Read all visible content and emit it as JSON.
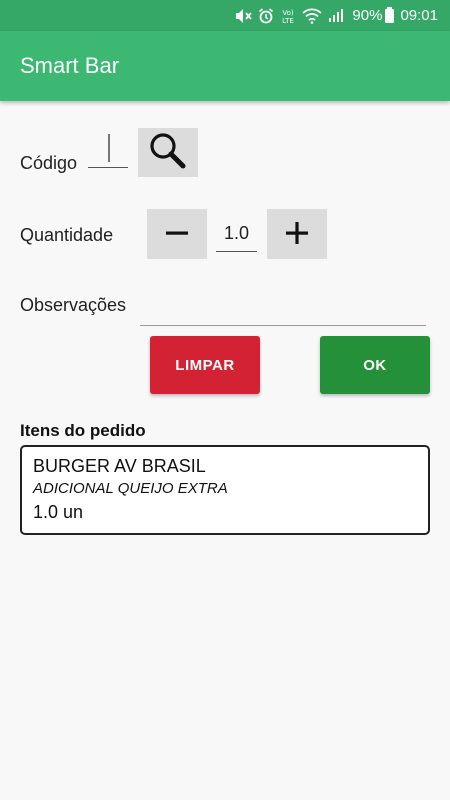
{
  "status_bar": {
    "battery": "90%",
    "time": "09:01",
    "network_label": "Vo) LTE",
    "icons": [
      "mute-icon",
      "alarm-icon",
      "volte-icon",
      "wifi-icon",
      "signal-icon",
      "battery-icon"
    ]
  },
  "app_bar": {
    "title": "Smart Bar"
  },
  "form": {
    "codigo_label": "Código",
    "codigo_value": "",
    "quantidade_label": "Quantidade",
    "quantidade_value": "1.0",
    "observacoes_label": "Observações",
    "observacoes_value": ""
  },
  "buttons": {
    "limpar_label": "LIMPAR",
    "ok_label": "OK"
  },
  "colors": {
    "status_bar": "#35a868",
    "app_bar": "#3cb873",
    "limpar": "#d32234",
    "ok": "#24913a",
    "icon_button": "#dcdcdc"
  },
  "order": {
    "title": "Itens do pedido",
    "items": [
      {
        "name": "BURGER AV BRASIL",
        "note": "ADICIONAL QUEIJO EXTRA",
        "qty": "1.0 un"
      }
    ]
  }
}
